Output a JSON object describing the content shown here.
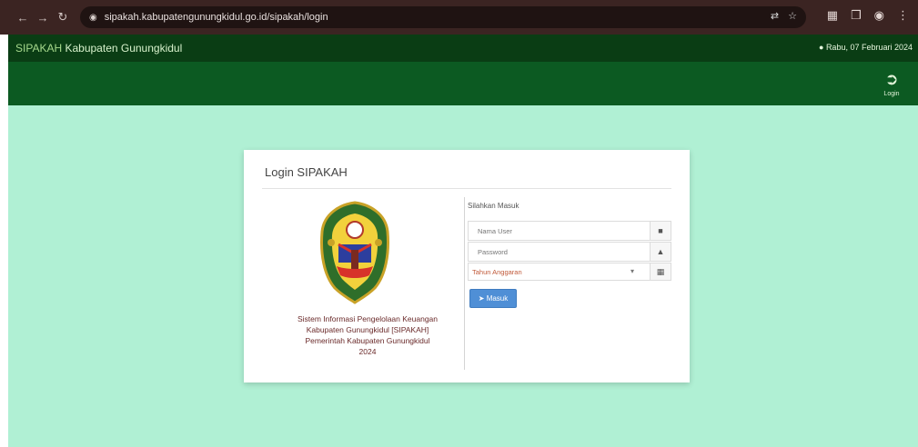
{
  "browser": {
    "url": "sipakah.kabupatengunungkidul.go.id/sipakah/login",
    "back_icon": "arrow-left-icon",
    "forward_icon": "arrow-right-icon",
    "reload_icon": "reload-icon"
  },
  "header": {
    "brand_code": "SIPAKAH",
    "brand_name": "Kabupaten Gunungkidul",
    "user_info": "Rabu, 07 Februari 2024"
  },
  "menu": {
    "logout_label": "Login",
    "logout_icon": "sign-in-icon"
  },
  "login": {
    "title": "Login SIPAKAH",
    "form_label": "Silahkan Masuk",
    "username_placeholder": "Nama User",
    "password_placeholder": "Password",
    "year_value": "Tahun Anggaran",
    "login_button": "Masuk",
    "description": [
      "Sistem Informasi Pengelolaan Keuangan",
      "Kabupaten Gunungkidul [SIPAKAH]",
      "Pemerintah Kabupaten Gunungkidul",
      "2024"
    ]
  },
  "colors": {
    "browser_bar": "#3b2422",
    "header": "#0a3d14",
    "menu": "#0c5a22",
    "content_bg": "#b0f0d4",
    "button": "#4f8fd6"
  }
}
